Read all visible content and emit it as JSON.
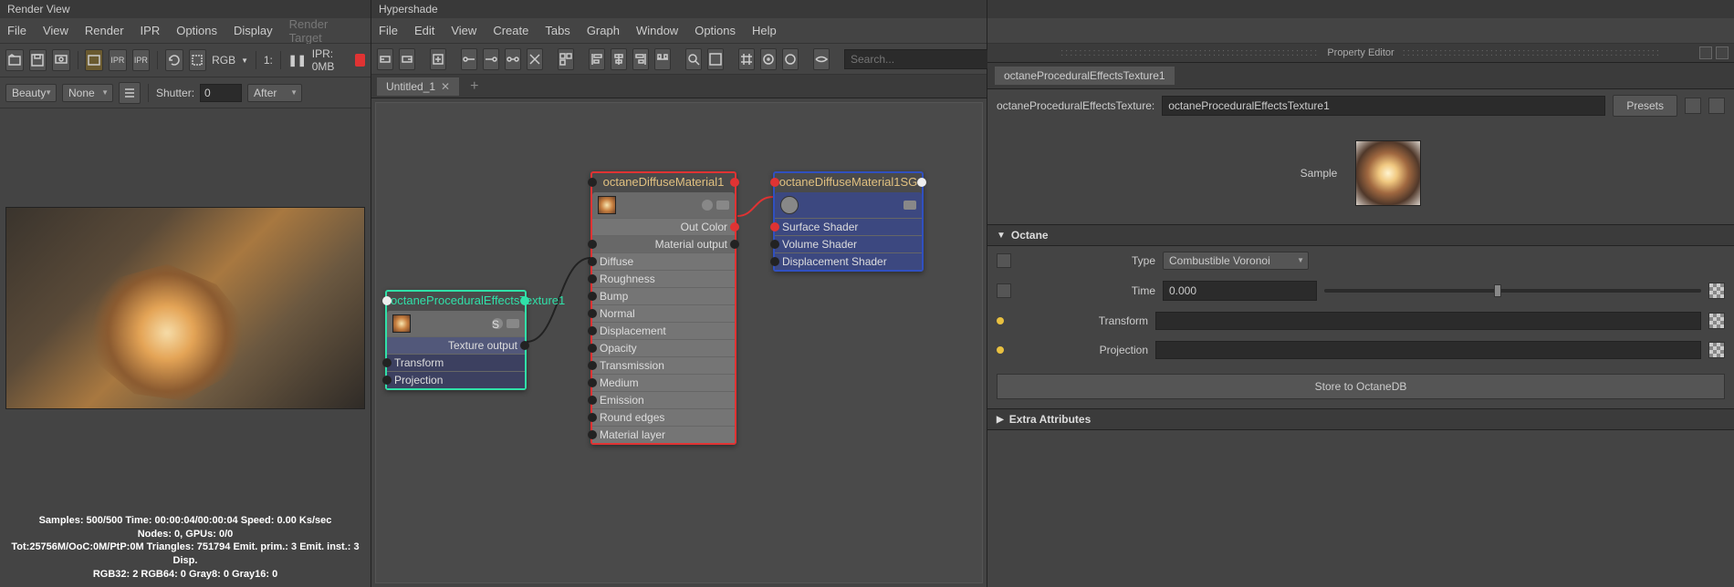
{
  "renderView": {
    "title": "Render View",
    "menu": [
      "File",
      "View",
      "Render",
      "IPR",
      "Options",
      "Display",
      "Render Target"
    ],
    "rgbLabel": "RGB",
    "oneX": "1:",
    "iprLabel": "IPR: 0MB",
    "beauty": "Beauty",
    "none": "None",
    "shutter": "Shutter:",
    "shutterVal": "0",
    "after": "After",
    "stats": {
      "l1": "Samples: 500/500 Time: 00:00:04/00:00:04 Speed: 0.00 Ks/sec",
      "l2": "Nodes: 0, GPUs: 0/0",
      "l3": "Tot:25756M/OoC:0M/PtP:0M Triangles: 751794 Emit. prim.: 3 Emit. inst.: 3 Disp.",
      "l4": "RGB32: 2 RGB64: 0 Gray8: 0 Gray16: 0"
    }
  },
  "hypershade": {
    "title": "Hypershade",
    "menu": [
      "File",
      "Edit",
      "View",
      "Create",
      "Tabs",
      "Graph",
      "Window",
      "Options",
      "Help"
    ],
    "searchPlaceholder": "Search...",
    "tab": "Untitled_1",
    "nodes": {
      "tex": {
        "title": "octaneProceduralEffectsTexture1",
        "out": "Texture output",
        "rows": [
          "Transform",
          "Projection"
        ]
      },
      "diff": {
        "title": "octaneDiffuseMaterial1",
        "outColor": "Out Color",
        "matOut": "Material output",
        "rows": [
          "Diffuse",
          "Roughness",
          "Bump",
          "Normal",
          "Displacement",
          "Opacity",
          "Transmission",
          "Medium",
          "Emission",
          "Round edges",
          "Material layer"
        ]
      },
      "sg": {
        "title": "octaneDiffuseMaterial1SG",
        "rows": [
          "Surface Shader",
          "Volume Shader",
          "Displacement Shader"
        ]
      }
    }
  },
  "propEditor": {
    "title": "Property Editor",
    "tab": "octaneProceduralEffectsTexture1",
    "typeLabel": "octaneProceduralEffectsTexture:",
    "typeValue": "octaneProceduralEffectsTexture1",
    "presets": "Presets",
    "sample": "Sample",
    "sectionOctane": "Octane",
    "type": "Type",
    "typeVal": "Combustible Voronoi",
    "time": "Time",
    "timeVal": "0.000",
    "transform": "Transform",
    "projection": "Projection",
    "storeBtn": "Store to OctaneDB",
    "extraAttr": "Extra Attributes"
  }
}
